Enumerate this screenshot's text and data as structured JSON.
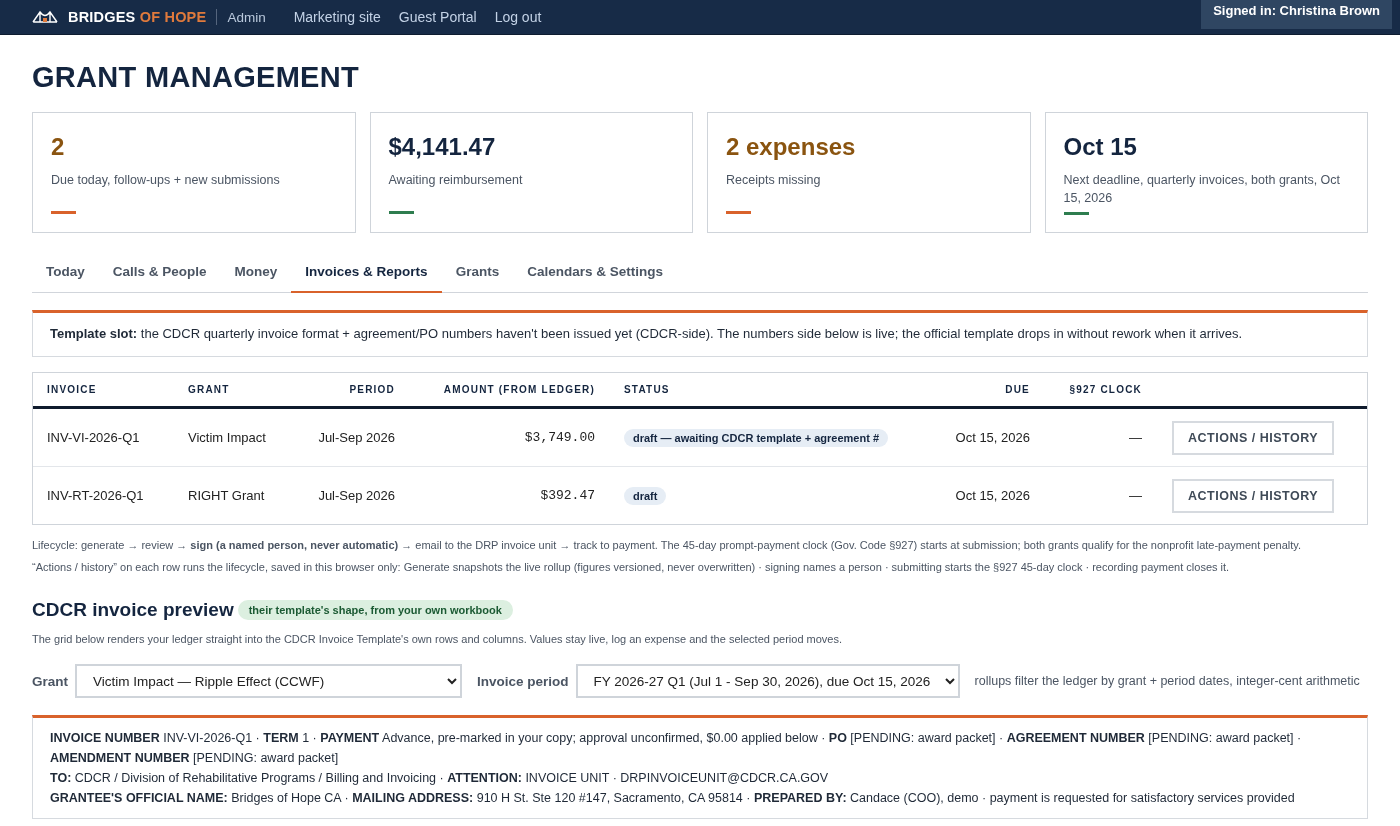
{
  "topbar": {
    "brand_primary": "BRIDGES",
    "brand_accent": "OF HOPE",
    "section": "Admin",
    "links": [
      "Marketing site",
      "Guest Portal",
      "Log out"
    ],
    "signed_in": "Signed in: Christina Brown"
  },
  "page_title": "GRANT MANAGEMENT",
  "stats": [
    {
      "value": "2",
      "label": "Due today, follow-ups + new submissions",
      "kind": "attention"
    },
    {
      "value": "$4,141.47",
      "label": "Awaiting reimbursement",
      "kind": "normal"
    },
    {
      "value": "2 expenses",
      "label": "Receipts missing",
      "kind": "attention"
    },
    {
      "value": "Oct 15",
      "label": "Next deadline, quarterly invoices, both grants, Oct 15, 2026",
      "kind": "normal"
    }
  ],
  "tabs": [
    {
      "label": "Today",
      "selected": false
    },
    {
      "label": "Calls & People",
      "selected": false
    },
    {
      "label": "Money",
      "selected": false
    },
    {
      "label": "Invoices & Reports",
      "selected": true
    },
    {
      "label": "Grants",
      "selected": false
    },
    {
      "label": "Calendars & Settings",
      "selected": false
    }
  ],
  "notice": "**Template slot:** the CDCR quarterly invoice format + agreement/PO numbers haven't been issued yet (CDCR-side). The numbers side below is live; the official template drops in without rework when it arrives.",
  "table": {
    "columns": [
      "INVOICE",
      "GRANT",
      "PERIOD",
      "AMOUNT (FROM LEDGER)",
      "STATUS",
      "DUE",
      "§927 CLOCK"
    ],
    "rows": [
      {
        "invoice": "INV-VI-2026-Q1",
        "grant": "Victim Impact",
        "period": "Jul-Sep 2026",
        "amount": "$3,749.00",
        "status": "draft — awaiting CDCR template + agreement #",
        "due": "Oct 15, 2026",
        "clock": "—",
        "action": "ACTIONS / HISTORY"
      },
      {
        "invoice": "INV-RT-2026-Q1",
        "grant": "RIGHT Grant",
        "period": "Jul-Sep 2026",
        "amount": "$392.47",
        "status": "draft",
        "due": "Oct 15, 2026",
        "clock": "—",
        "action": "ACTIONS / HISTORY"
      }
    ]
  },
  "notes": [
    "Lifecycle: generate → review → **sign (a named person, never automatic)** → email to the DRP invoice unit → track to payment. The 45-day prompt-payment clock (Gov. Code §927) starts at submission; both grants qualify for the nonprofit late-payment penalty.",
    "“Actions / history” on each row runs the lifecycle, saved in this browser only: Generate snapshots the live rollup (figures versioned, never overwritten) · signing names a person · submitting starts the §927 45-day clock · recording payment closes it."
  ],
  "preview": {
    "title": "CDCR invoice preview",
    "badge": "their template's shape, from your own workbook",
    "description": "The grid below renders your ledger straight into the CDCR Invoice Template's own rows and columns. Values stay live, log an expense and the selected period moves.",
    "grant_label": "Grant",
    "grant_value": "Victim Impact — Ripple Effect (CCWF)",
    "period_label": "Invoice period",
    "period_value": "FY 2026-27 Q1 (Jul 1 - Sep 30, 2026), due Oct 15, 2026",
    "hint": "rollups filter the ledger by grant + period dates, integer-cent arithmetic",
    "lines": [
      "**INVOICE NUMBER** INV-VI-2026-Q1 · **TERM** 1 · **PAYMENT** Advance, pre-marked in your copy; approval unconfirmed, $0.00 applied below · **PO** [PENDING: award packet] · **AGREEMENT NUMBER** [PENDING: award packet] · **AMENDMENT NUMBER** [PENDING: award packet]",
      "**TO:** CDCR / Division of Rehabilitative Programs / Billing and Invoicing · **ATTENTION:** INVOICE UNIT · DRPINVOICEUNIT@CDCR.CA.GOV",
      "**GRANTEE'S OFFICIAL NAME:** Bridges of Hope CA · **MAILING ADDRESS:** 910 H St. Ste 120 #147, Sacramento, CA 95814 · **PREPARED BY:** Candace (COO), demo · payment is requested for satisfactory services provided"
    ]
  }
}
